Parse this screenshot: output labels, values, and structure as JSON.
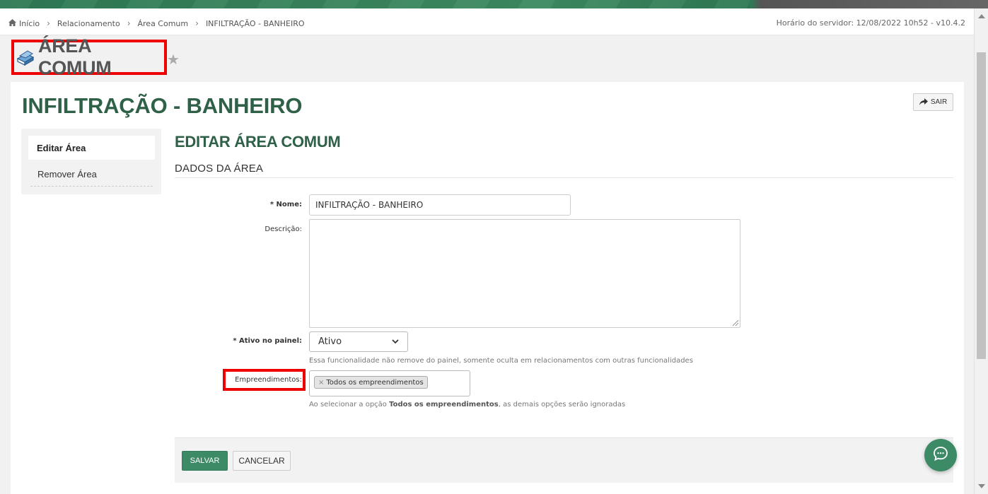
{
  "colors": {
    "brand_green": "#2f6148",
    "button_green": "#3c8a66",
    "highlight_red": "#e00000"
  },
  "breadcrumb": {
    "items": [
      "Início",
      "Relacionamento",
      "Área Comum",
      "INFILTRAÇÃO - BANHEIRO"
    ]
  },
  "header": {
    "server_time": "Horário do servidor: 12/08/2022 10h52 - v10.4.2"
  },
  "page": {
    "title": "ÁREA COMUM"
  },
  "record": {
    "title": "INFILTRAÇÃO - BANHEIRO",
    "exit_label": "SAIR"
  },
  "sidebar": {
    "items": [
      {
        "label": "Editar Área",
        "active": true
      },
      {
        "label": "Remover Área",
        "active": false
      }
    ]
  },
  "form": {
    "title": "EDITAR ÁREA COMUM",
    "section": "DADOS DA ÁREA",
    "nome": {
      "label": "* Nome:",
      "value": "INFILTRAÇÃO - BANHEIRO"
    },
    "descricao": {
      "label": "Descrição:",
      "value": ""
    },
    "ativo": {
      "label": "* Ativo no painel:",
      "value": "Ativo",
      "help": "Essa funcionalidade não remove do painel, somente oculta em relacionamentos com outras funcionalidades"
    },
    "empreendimentos": {
      "label": "Empreendimentos:",
      "tag": "Todos os empreendimentos",
      "help_prefix": "Ao selecionar a opção ",
      "help_bold": "Todos os empreendimentos",
      "help_suffix": ", as demais opções serão ignoradas"
    }
  },
  "actions": {
    "save_label": "SALVAR",
    "cancel_label": "CANCELAR"
  },
  "icons": {
    "home": "home-icon",
    "star": "star-icon",
    "book": "book-icon",
    "share": "share-icon",
    "chat": "chat-icon"
  }
}
